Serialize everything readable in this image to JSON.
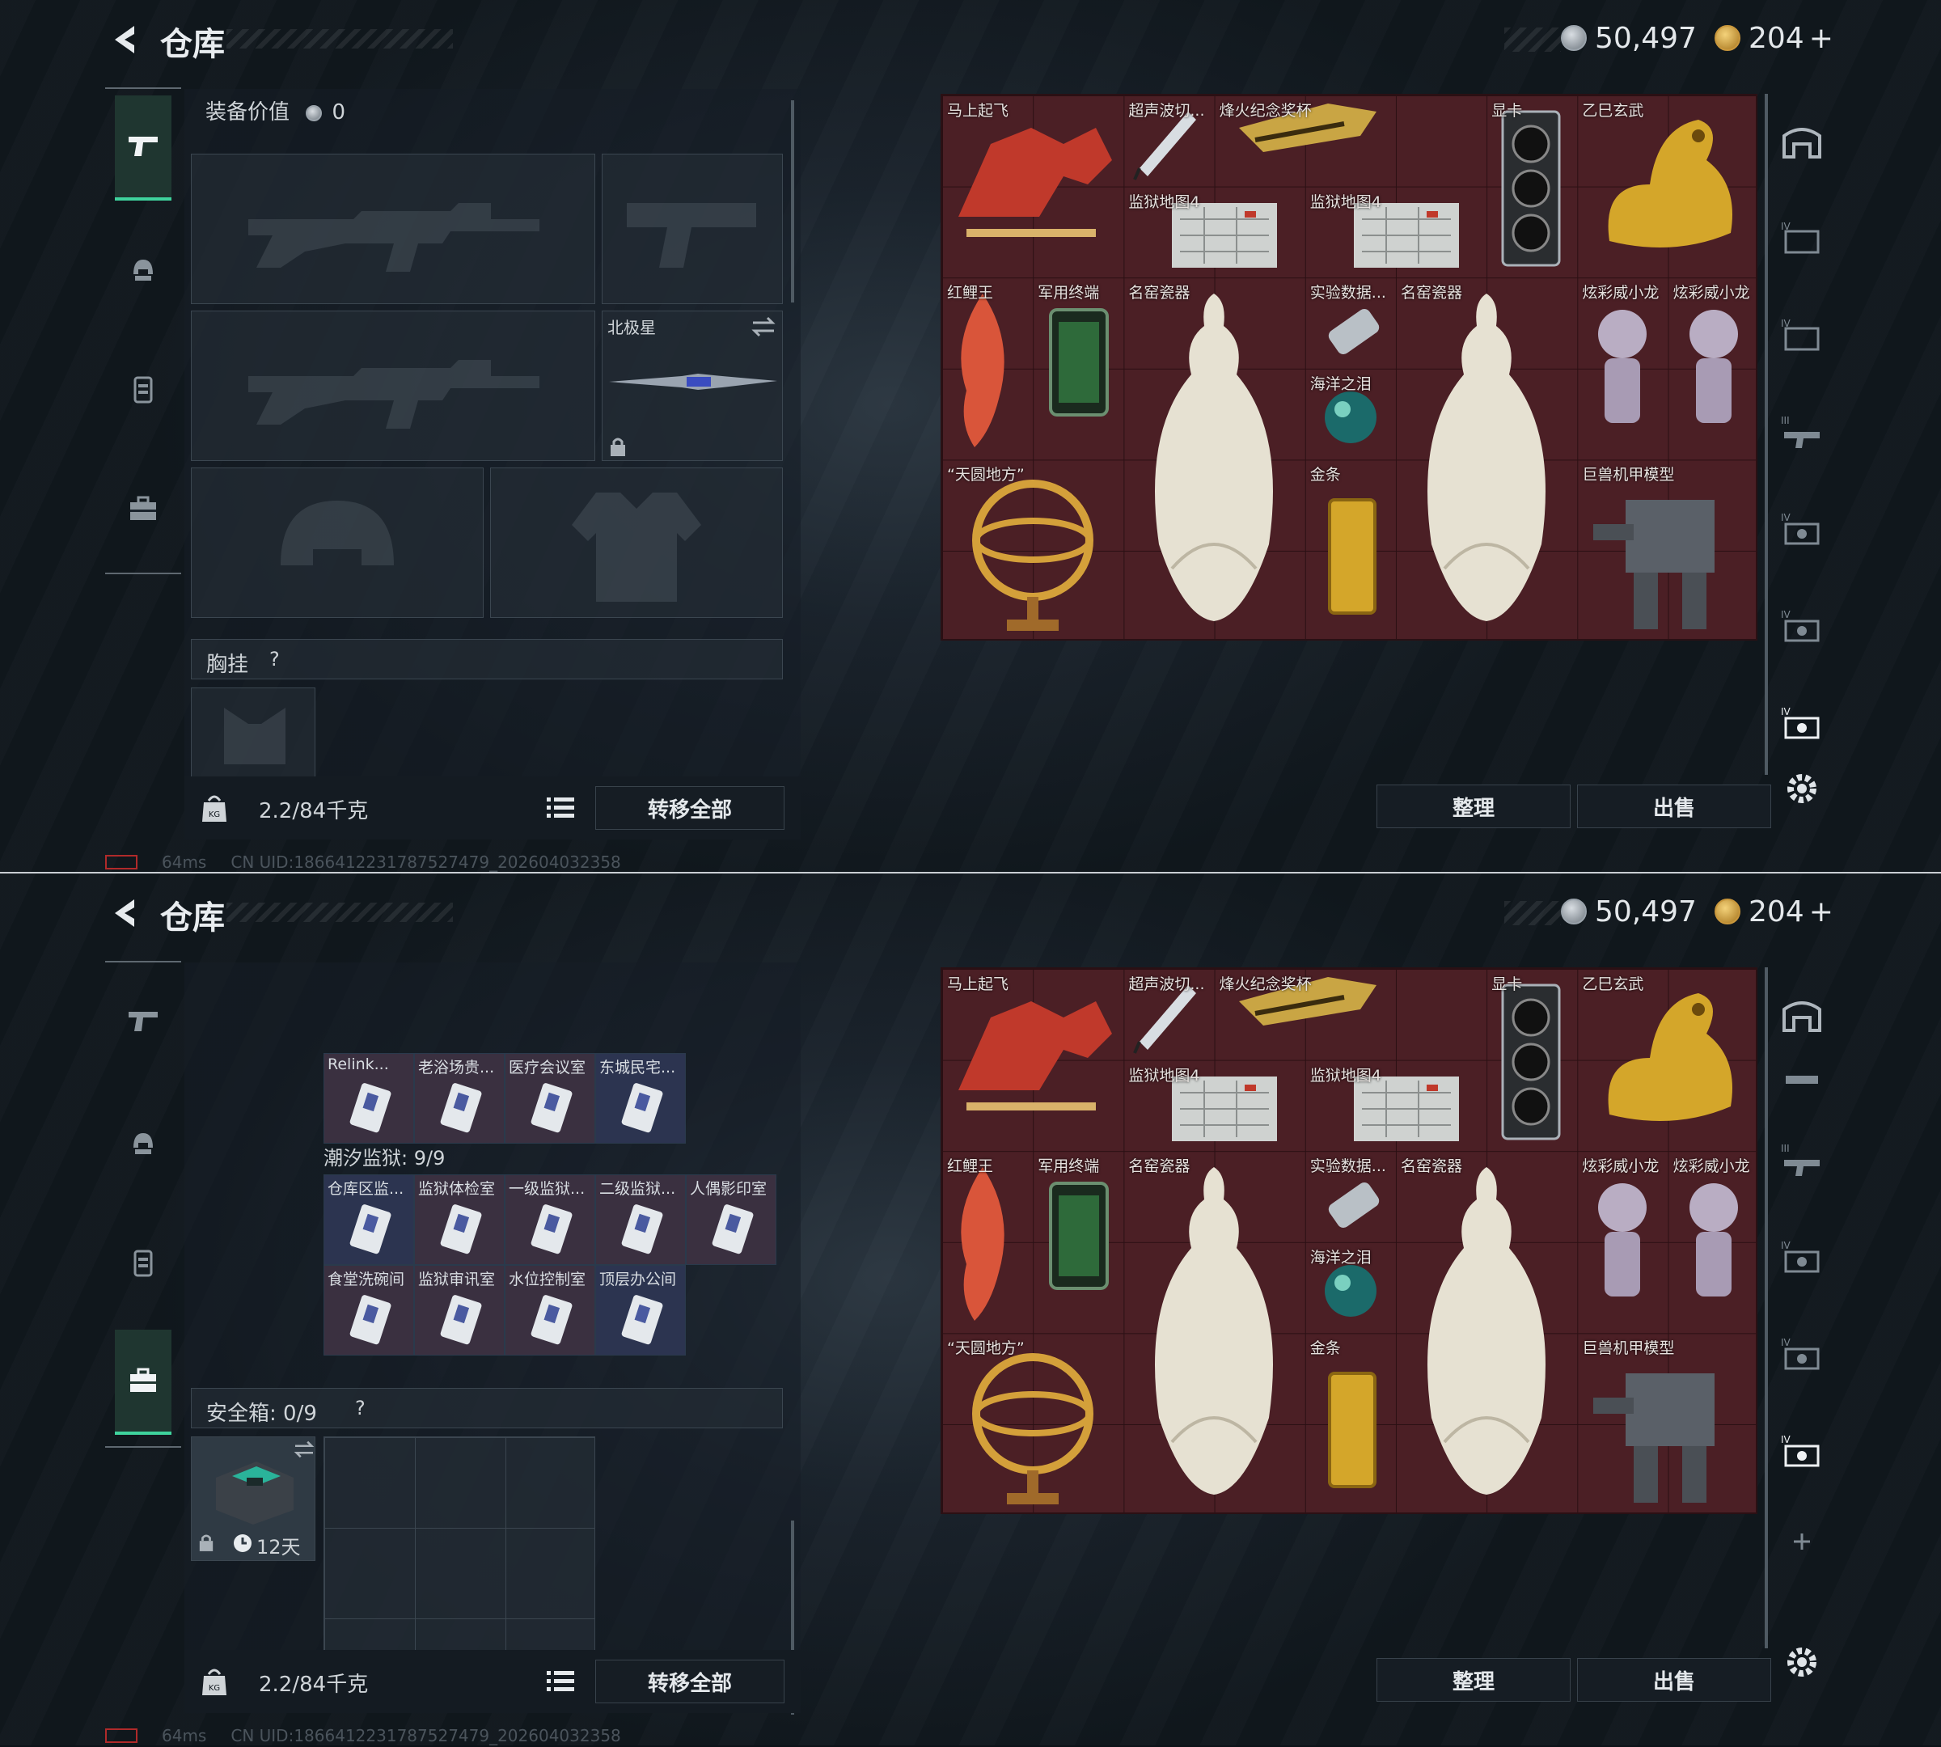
{
  "header": {
    "title": "仓库",
    "silver": "50,497",
    "gold": "204"
  },
  "plus_glyph": "+",
  "status": {
    "ping": "64ms",
    "uid": "CN UID:1866412231787527479_202604032358"
  },
  "loadout": {
    "value_label": "装备价值",
    "value": "0",
    "knife_name": "北极星",
    "chest_label": "胸挂",
    "help": "?",
    "weight": "2.2/84千克",
    "transfer_all": "转移全部"
  },
  "storage": {
    "sort": "整理",
    "sell": "出售"
  },
  "items": [
    {
      "name": "马上起飞"
    },
    {
      "name": "超声波切..."
    },
    {
      "name": "烽火纪念奖杯"
    },
    {
      "name": "显卡"
    },
    {
      "name": "乙巳玄武"
    },
    {
      "name": "监狱地图4"
    },
    {
      "name": "监狱地图4"
    },
    {
      "name": "红鲤王"
    },
    {
      "name": "军用终端"
    },
    {
      "name": "名窑瓷器"
    },
    {
      "name": "实验数据..."
    },
    {
      "name": "名窑瓷器"
    },
    {
      "name": "炫彩威小龙"
    },
    {
      "name": "炫彩威小龙"
    },
    {
      "name": "海洋之泪"
    },
    {
      "name": "“天圆地方”"
    },
    {
      "name": "金条"
    },
    {
      "name": "巨兽机甲模型"
    }
  ],
  "keys": {
    "row0": [
      "Relink...",
      "老浴场贵...",
      "医疗会议室",
      "东城民宅..."
    ],
    "prison_label": "潮汐监狱: 9/9",
    "row1": [
      "仓库区监...",
      "监狱体检室",
      "一级监狱...",
      "二级监狱...",
      "人偶影印室"
    ],
    "row2": [
      "食堂洗碗间",
      "监狱审讯室",
      "水位控制室",
      "顶层办公间"
    ]
  },
  "safebox": {
    "label": "安全箱: 0/9",
    "days": "12天"
  }
}
